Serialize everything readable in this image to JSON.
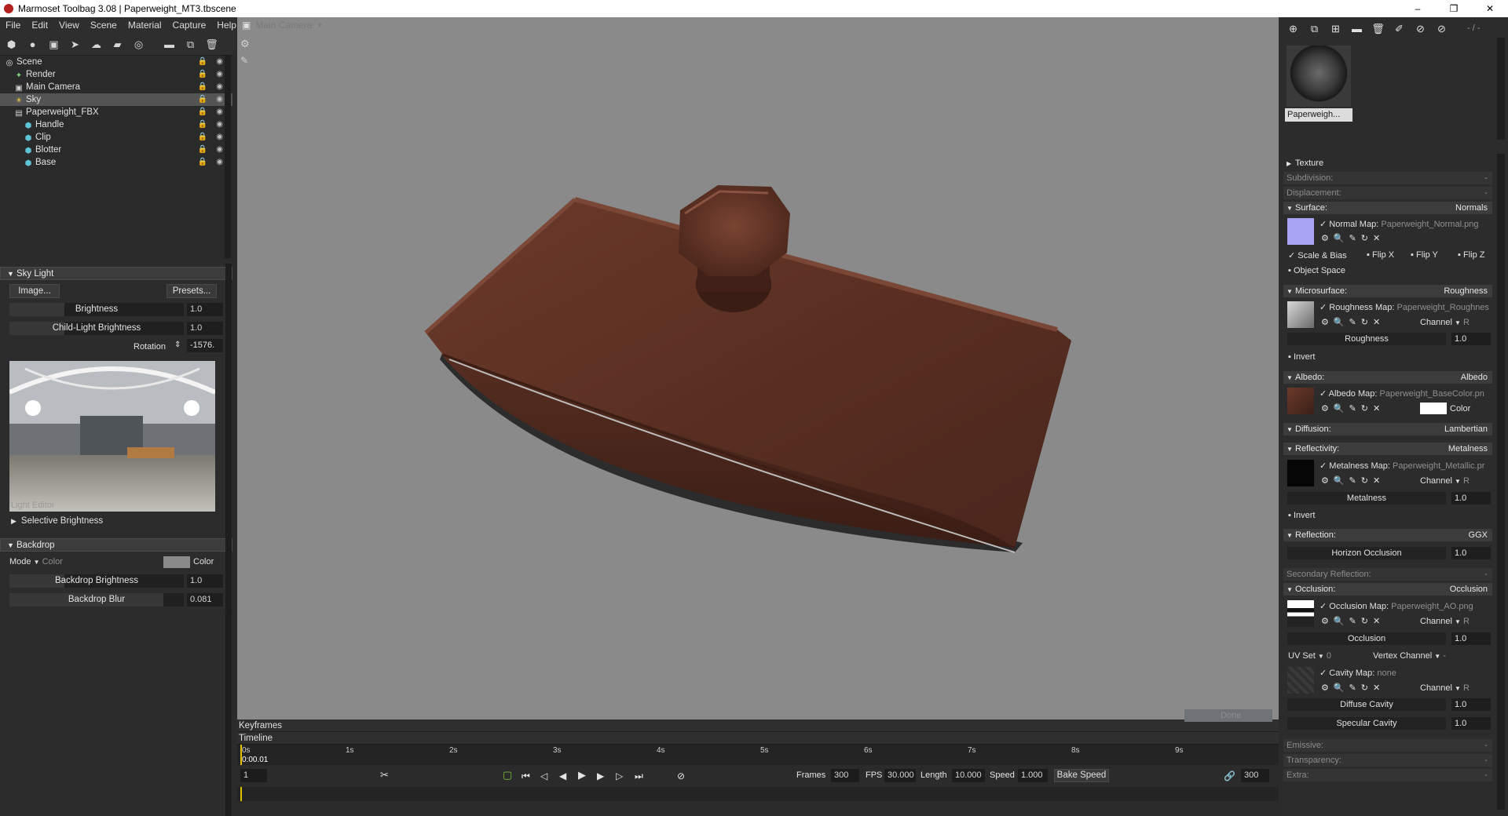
{
  "window": {
    "title": "Marmoset Toolbag 3.08  |  Paperweight_MT3.tbscene",
    "controls": [
      "–",
      "❐",
      "✕"
    ]
  },
  "menu": [
    "File",
    "Edit",
    "View",
    "Scene",
    "Material",
    "Capture",
    "Help"
  ],
  "outliner": {
    "items": [
      {
        "label": "Scene",
        "icon": "scene-icon",
        "indent": 0,
        "selected": false
      },
      {
        "label": "Render",
        "icon": "render-icon",
        "indent": 1,
        "selected": false
      },
      {
        "label": "Main Camera",
        "icon": "camera-icon",
        "indent": 1,
        "selected": false
      },
      {
        "label": "Sky",
        "icon": "sky-icon",
        "indent": 1,
        "selected": true
      },
      {
        "label": "Paperweight_FBX",
        "icon": "fbx-icon",
        "indent": 1,
        "selected": false
      },
      {
        "label": "Handle",
        "icon": "mesh-icon",
        "indent": 2,
        "selected": false
      },
      {
        "label": "Clip",
        "icon": "mesh-icon",
        "indent": 2,
        "selected": false
      },
      {
        "label": "Blotter",
        "icon": "mesh-icon",
        "indent": 2,
        "selected": false
      },
      {
        "label": "Base",
        "icon": "mesh-icon",
        "indent": 2,
        "selected": false
      }
    ]
  },
  "skylight": {
    "header": "Sky Light",
    "image_btn": "Image...",
    "presets_btn": "Presets...",
    "brightness_label": "Brightness",
    "brightness_value": "1.0",
    "child_label": "Child-Light Brightness",
    "child_value": "1.0",
    "rotation_label": "Rotation",
    "rotation_value": "-1576.",
    "light_editor_label": "Light Editor",
    "selective_label": "Selective Brightness"
  },
  "backdrop": {
    "header": "Backdrop",
    "mode_label": "Mode",
    "mode_value": "Color",
    "color_label": "Color",
    "brightness_label": "Backdrop Brightness",
    "brightness_value": "1.0",
    "blur_label": "Backdrop Blur",
    "blur_value": "0.081"
  },
  "viewport": {
    "camera_label": "Main Camera"
  },
  "material": {
    "name": "Paperweigh...",
    "sections": {
      "texture": "Texture",
      "subdivision": "Subdivision:",
      "displacement": "Displacement:",
      "surface": "Surface:",
      "surface_value": "Normals",
      "microsurface": "Microsurface:",
      "microsurface_value": "Roughness",
      "albedo": "Albedo:",
      "albedo_value": "Albedo",
      "diffusion": "Diffusion:",
      "diffusion_value": "Lambertian",
      "reflectivity": "Reflectivity:",
      "reflectivity_value": "Metalness",
      "reflection": "Reflection:",
      "reflection_value": "GGX",
      "secondary": "Secondary Reflection:",
      "occlusion": "Occlusion:",
      "occlusion_value": "Occlusion",
      "emissive": "Emissive:",
      "transparency": "Transparency:",
      "extra": "Extra:",
      "dash": "-"
    },
    "normal_map": {
      "label": "Normal Map:",
      "file": "Paperweight_Normal.png"
    },
    "scale_bias": "Scale & Bias",
    "flip_x": "Flip X",
    "flip_y": "Flip Y",
    "flip_z": "Flip Z",
    "object_space": "Object Space",
    "roughness_map": {
      "label": "Roughness Map:",
      "file": "Paperweight_Roughnes"
    },
    "channel": "Channel",
    "channel_r": "R",
    "roughness_label": "Roughness",
    "roughness_value": "1.0",
    "invert": "Invert",
    "albedo_map": {
      "label": "Albedo Map:",
      "file": "Paperweight_BaseColor.pn"
    },
    "color": "Color",
    "metalness_map": {
      "label": "Metalness Map:",
      "file": "Paperweight_Metallic.pr"
    },
    "metalness_label": "Metalness",
    "metalness_value": "1.0",
    "horizon_label": "Horizon Occlusion",
    "horizon_value": "1.0",
    "occlusion_map": {
      "label": "Occlusion Map:",
      "file": "Paperweight_AO.png"
    },
    "occlusion_label": "Occlusion",
    "occlusion_value": "1.0",
    "uv_set": "UV Set",
    "uv_value": "0",
    "vertex_channel": "Vertex Channel",
    "cavity_map": {
      "label": "Cavity Map:",
      "file": "none"
    },
    "diffuse_cavity": "Diffuse Cavity",
    "diffuse_cavity_value": "1.0",
    "specular_cavity": "Specular Cavity",
    "specular_cavity_value": "1.0",
    "toolbar_value": "- / -"
  },
  "timeline": {
    "keyframes": "Keyframes",
    "timeline": "Timeline",
    "ticks": [
      "0s",
      "1s",
      "2s",
      "3s",
      "4s",
      "5s",
      "6s",
      "7s",
      "8s",
      "9s"
    ],
    "current": "0:00.01",
    "frame_field": "1",
    "frames_label": "Frames",
    "frames_value": "300",
    "fps_label": "FPS",
    "fps_value": "30.000",
    "length_label": "Length",
    "length_value": "10.000",
    "speed_label": "Speed",
    "speed_value": "1.000",
    "bake_speed": "Bake Speed",
    "end_value": "300",
    "done_ghost": "Done"
  }
}
